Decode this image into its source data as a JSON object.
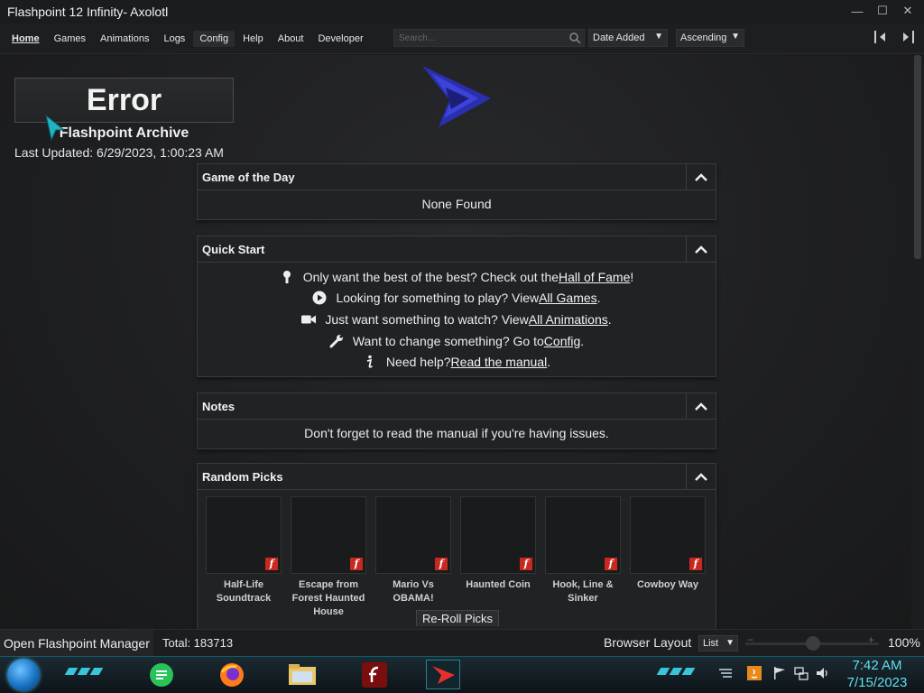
{
  "window": {
    "title": "Flashpoint 12 Infinity- Axolotl",
    "minimize": "—",
    "maximize": "☐",
    "close": "✕"
  },
  "menu": {
    "items": [
      "Home",
      "Games",
      "Animations",
      "Logs",
      "Config",
      "Help",
      "About",
      "Developer"
    ],
    "active": "Home"
  },
  "search": {
    "placeholder": "Search..."
  },
  "sort": {
    "field": "Date Added",
    "order": "Ascending"
  },
  "logo": {
    "error_text": "Error",
    "archive_title": "Flashpoint Archive"
  },
  "last_updated": "Last Updated: 6/29/2023, 1:00:23 AM",
  "panels": {
    "game_of_the_day": {
      "title": "Game of the Day",
      "body": "None Found"
    },
    "quick_start": {
      "title": "Quick Start",
      "rows": [
        {
          "icon": "medal-icon",
          "pre": "Only want the best of the best? Check out the ",
          "link": "Hall of Fame",
          "post": "!"
        },
        {
          "icon": "play-circle-icon",
          "pre": "Looking for something to play? View ",
          "link": "All Games",
          "post": "."
        },
        {
          "icon": "video-camera-icon",
          "pre": "Just want something to watch? View ",
          "link": "All Animations",
          "post": "."
        },
        {
          "icon": "wrench-icon",
          "pre": "Want to change something? Go to ",
          "link": "Config",
          "post": "."
        },
        {
          "icon": "info-icon",
          "pre": "Need help? ",
          "link": "Read the manual",
          "post": "."
        }
      ]
    },
    "notes": {
      "title": "Notes",
      "body": "Don't forget to read the manual if you're having issues."
    },
    "random_picks": {
      "title": "Random Picks",
      "games": [
        "Half-Life Soundtrack",
        "Escape from Forest Haunted House",
        "Mario Vs OBAMA!",
        "Haunted Coin",
        "Hook, Line & Sinker",
        "Cowboy Way"
      ],
      "reroll_label": "Re-Roll Picks"
    }
  },
  "status": {
    "open_manager": "Open Flashpoint Manager",
    "total": "Total: 183713",
    "browser_layout": "Browser Layout",
    "layout_value": "List",
    "zoom": "100%"
  },
  "taskbar": {
    "time": "7:42 AM",
    "date": "7/15/2023",
    "accent": "#5fe0ee"
  }
}
